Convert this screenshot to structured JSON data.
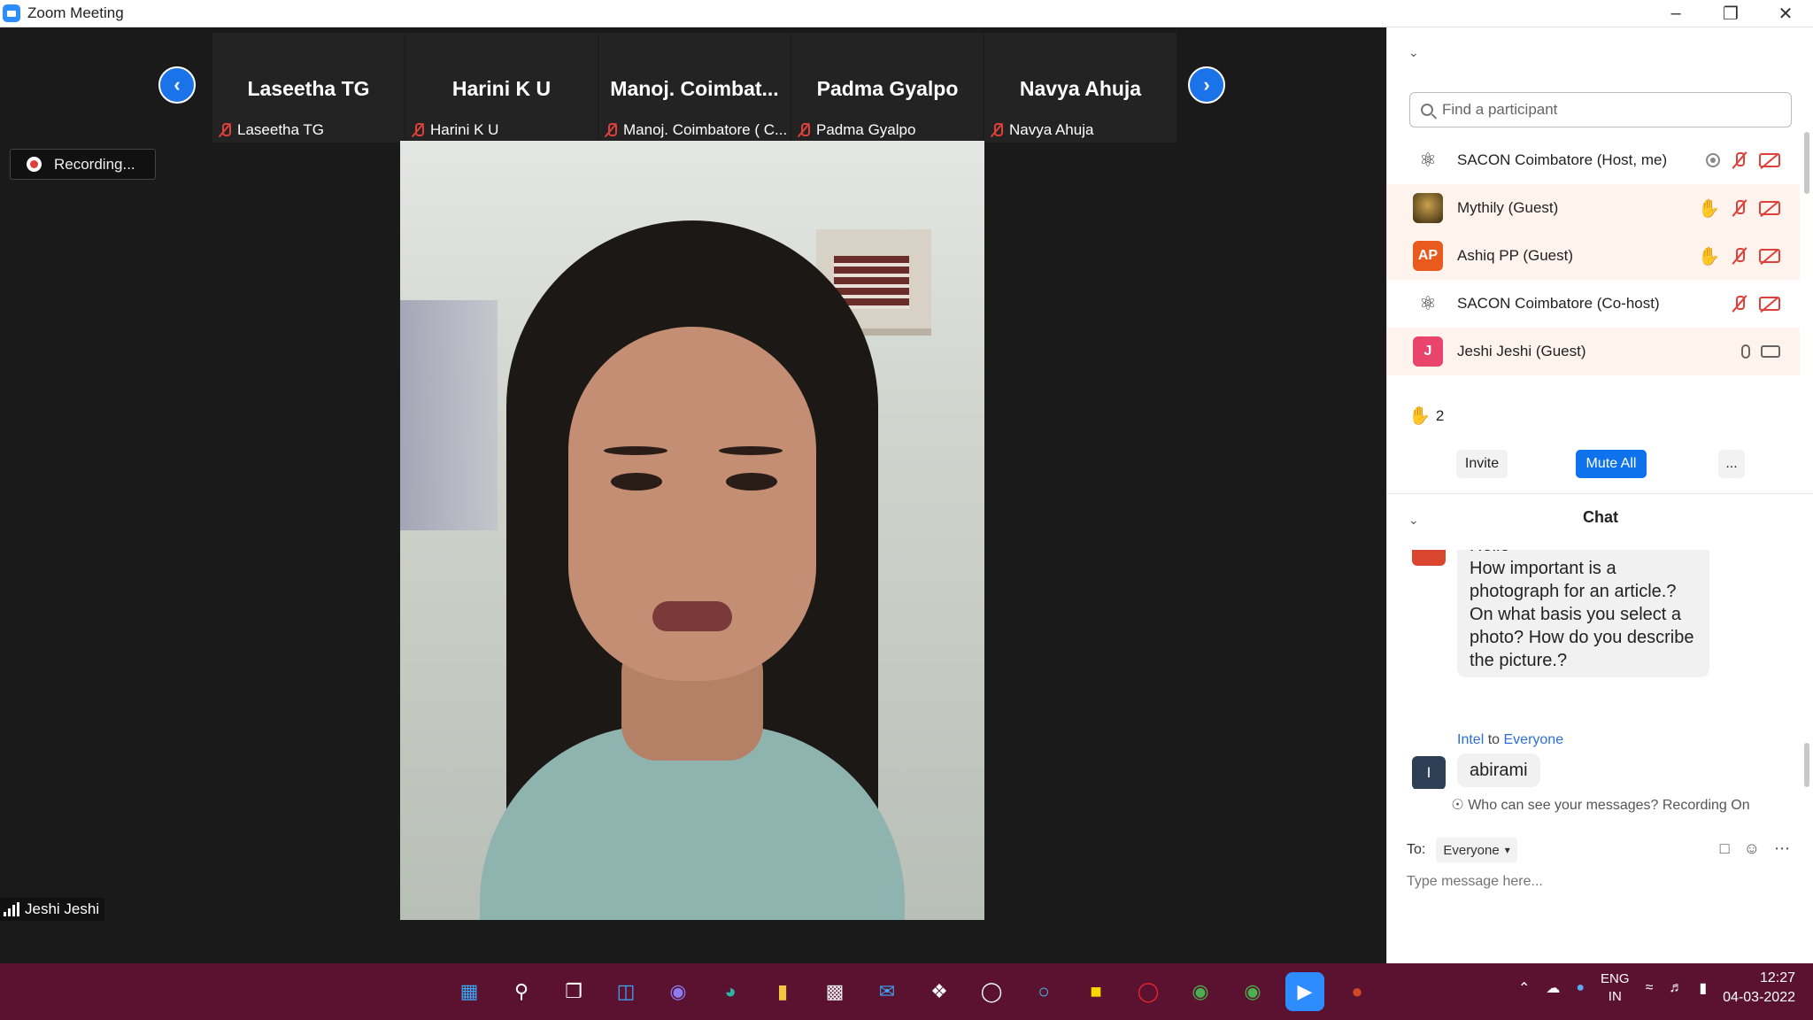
{
  "window": {
    "title": "Zoom Meeting"
  },
  "gallery": {
    "thumbnails": [
      {
        "display": "Laseetha TG",
        "label": "Laseetha TG"
      },
      {
        "display": "Harini K U",
        "label": "Harini K U"
      },
      {
        "display": "Manoj.  Coimbat...",
        "label": "Manoj. Coimbatore ( C..."
      },
      {
        "display": "Padma Gyalpo",
        "label": "Padma Gyalpo"
      },
      {
        "display": "Navya Ahuja",
        "label": "Navya Ahuja"
      }
    ]
  },
  "recording": {
    "label": "Recording..."
  },
  "active_speaker": {
    "name": "Jeshi Jeshi"
  },
  "participants": {
    "search_placeholder": "Find a participant",
    "list": [
      {
        "name": "SACON Coimbatore (Host, me)",
        "avatar": "logo"
      },
      {
        "name": "Mythily (Guest)",
        "avatar": "photo"
      },
      {
        "name": "Ashiq PP (Guest)",
        "avatar": "AP"
      },
      {
        "name": "SACON Coimbatore (Co-host)",
        "avatar": "logo"
      },
      {
        "name": "Jeshi Jeshi (Guest)",
        "avatar": "J"
      }
    ],
    "raised_hands_count": "2",
    "invite_label": "Invite",
    "mute_all_label": "Mute All",
    "more_label": "..."
  },
  "chat": {
    "title": "Chat",
    "message1_lines": [
      "Hello",
      "How important is a",
      "photograph for an article.?",
      "On what basis you select a",
      "photo? How do you describe",
      "the picture.?"
    ],
    "message2_sender": "Intel",
    "message2_to_word": "to",
    "message2_recipient": "Everyone",
    "message2_avatar": "I",
    "message2_text": "abirami",
    "visibility_notice": "Who can see your messages? Recording On",
    "to_label": "To:",
    "to_value": "Everyone",
    "input_placeholder": "Type message here..."
  },
  "taskbar": {
    "language_top": "ENG",
    "language_bottom": "IN",
    "time": "12:27",
    "date": "04-03-2022"
  },
  "colors": {
    "accent": "#0e72ed",
    "taskbar": "#5a1230",
    "muted_red": "#e0403a",
    "raised_hand": "#f4b400"
  }
}
